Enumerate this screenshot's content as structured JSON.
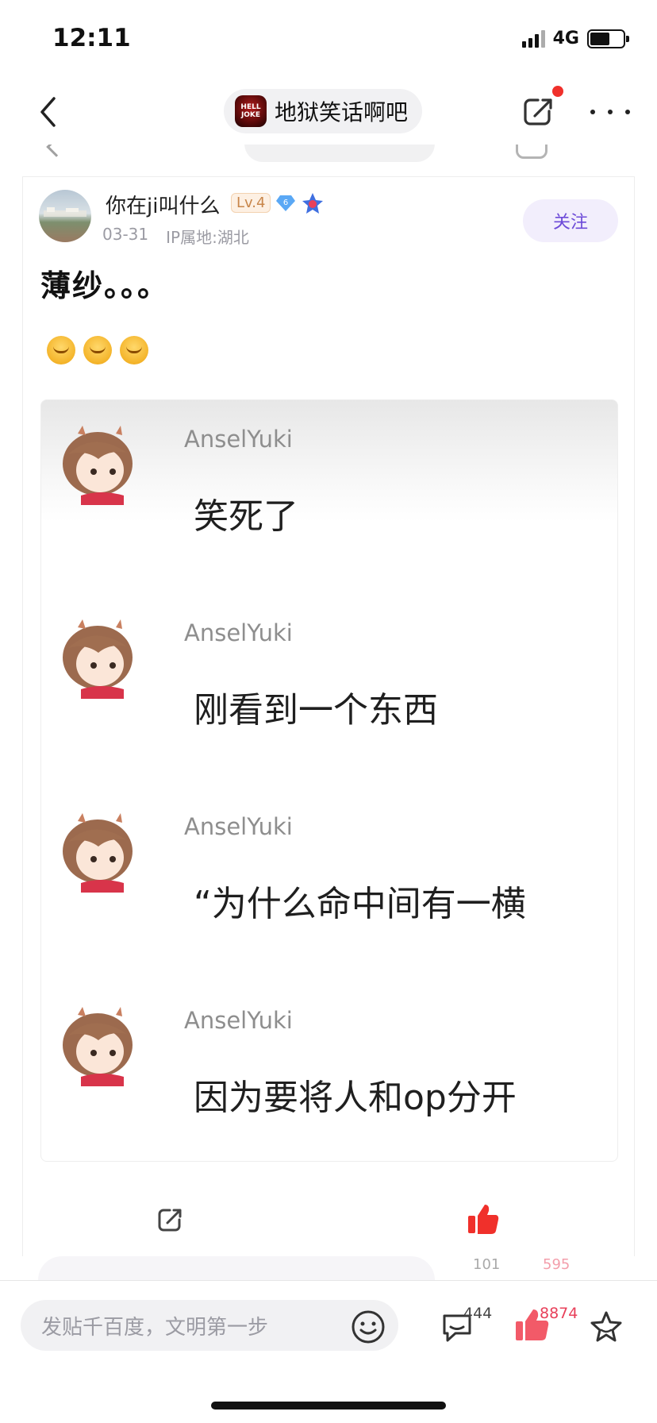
{
  "status_bar": {
    "time": "12:11",
    "network": "4G"
  },
  "nav": {
    "forum_name": "地狱笑话啊吧",
    "forum_logo_text": [
      "HELL",
      "JOKE"
    ]
  },
  "post": {
    "author": "你在ji叫什么",
    "level": "Lv.4",
    "gem_level": "6",
    "date": "03-31",
    "ip_location": "IP属地:湖北",
    "follow_label": "关注",
    "text": "薄纱。。。",
    "emoji_count": 3,
    "image_messages": [
      {
        "user": "AnselYuki",
        "text": "笑死了"
      },
      {
        "user": "AnselYuki",
        "text": "刚看到一个东西"
      },
      {
        "user": "AnselYuki",
        "text": "“为什么命中间有一横"
      },
      {
        "user": "AnselYuki",
        "text": "因为要将人和op分开"
      }
    ],
    "ghost_counts": {
      "comments": "101",
      "likes": "595"
    }
  },
  "bottom_bar": {
    "comment_placeholder": "发贴千百度，文明第一步",
    "comment_count": "444",
    "like_count": "8874"
  },
  "colors": {
    "accent_purple": "#6d4bd8",
    "like_red": "#f0302b",
    "muted_text": "#9b9ba3"
  }
}
